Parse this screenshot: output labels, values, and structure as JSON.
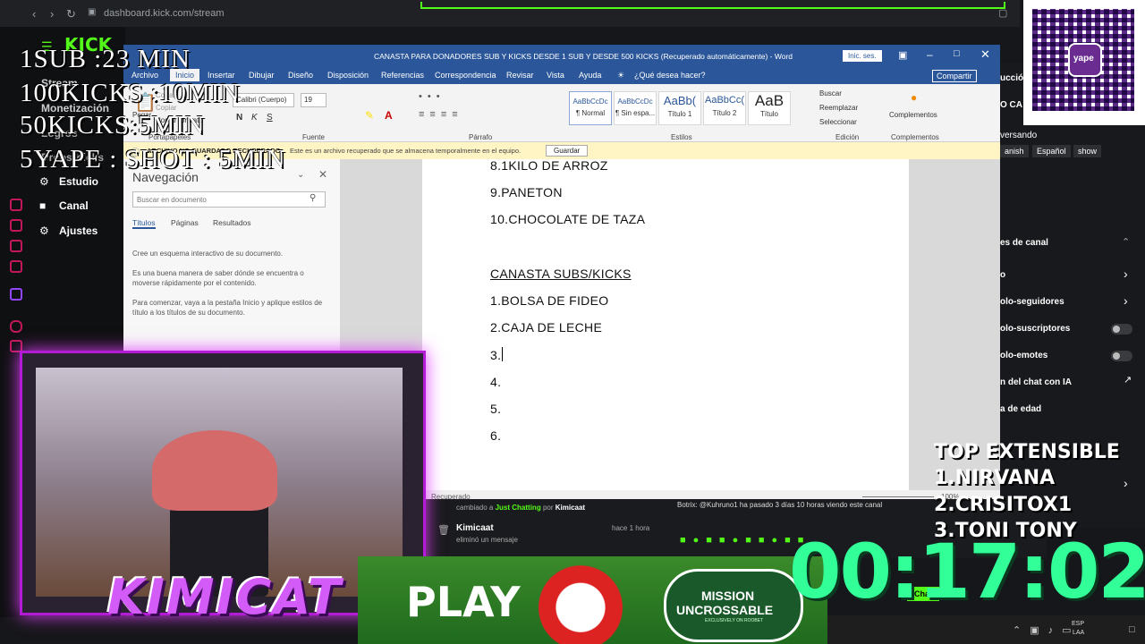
{
  "browser": {
    "url": "dashboard.kick.com/stream"
  },
  "kick_sidebar": {
    "logo": "KICK",
    "items": [
      {
        "label": "Stream"
      },
      {
        "label": "Monetización"
      },
      {
        "label": "Logros"
      },
      {
        "label": "Drops Kicks"
      },
      {
        "label": "Estudio"
      },
      {
        "label": "Canal"
      },
      {
        "label": "Ajustes"
      }
    ]
  },
  "overlay": {
    "lines": [
      "1SUB :23 MIN",
      "100KICKS :10MIN",
      "50KICKS:5MIN",
      "5YAPE : SHOT : 5MIN"
    ]
  },
  "word": {
    "title": "CANASTA PARA DONADORES SUB Y KICKS DESDE 1 SUB Y DESDE 500 KICKS (Recuperado automáticamente) - Word",
    "signin": "Inic. ses.",
    "share": "Compartir",
    "tabs": [
      "Archivo",
      "Inicio",
      "Insertar",
      "Dibujar",
      "Diseño",
      "Disposición",
      "Referencias",
      "Correspondencia",
      "Revisar",
      "Vista",
      "Ayuda"
    ],
    "tell_me": "¿Qué desea hacer?",
    "clipboard": {
      "paste": "Pegar",
      "cut": "Cortar",
      "copy": "Copiar",
      "format": "Copiar formato",
      "label": "Portapapeles"
    },
    "font": {
      "name": "Calibri (Cuerpo)",
      "size": "19",
      "label": "Fuente"
    },
    "paragraph_label": "Párrafo",
    "styles": [
      {
        "preview": "AaBbCcDc",
        "name": "¶ Normal"
      },
      {
        "preview": "AaBbCcDc",
        "name": "¶ Sin espa..."
      },
      {
        "preview": "AaBb(",
        "name": "Título 1"
      },
      {
        "preview": "AaBbCc(",
        "name": "Título 2"
      },
      {
        "preview": "AaB",
        "name": "Título"
      }
    ],
    "styles_label": "Estilos",
    "editing": {
      "find": "Buscar",
      "replace": "Reemplazar",
      "select": "Seleccionar",
      "label": "Edición"
    },
    "addins": {
      "label": "Complementos",
      "button": "Complementos"
    },
    "message_bar": {
      "title": "ARCHIVO NO GUARDADO RECUPERADO",
      "text": "Este es un archivo recuperado que se almacena temporalmente en el equipo.",
      "save": "Guardar"
    },
    "nav_pane": {
      "title": "Navegación",
      "search_placeholder": "Buscar en documento",
      "tabs": [
        "Títulos",
        "Páginas",
        "Resultados"
      ],
      "p1": "Cree un esquema interactivo de su documento.",
      "p2": "Es una buena manera de saber dónde se encuentra o moverse rápidamente por el contenido.",
      "p3": "Para comenzar, vaya a la pestaña Inicio y aplique estilos de título a los títulos de su documento."
    },
    "document": {
      "lines": [
        "8.1KILO DE ARROZ",
        "9.PANETON",
        "10.CHOCOLATE DE TAZA"
      ],
      "heading": "CANASTA SUBS/KICKS",
      "list": [
        "1.BOLSA DE FIDEO",
        "2.CAJA DE LECHE",
        "3.",
        "4.",
        "5.",
        "6."
      ]
    },
    "status": {
      "recovered": "Recuperado",
      "zoom": "100%"
    }
  },
  "right_panel": {
    "partial_top": [
      "ucción",
      "O CA",
      "versando"
    ],
    "lang_chips": [
      "anish",
      "Español",
      "show"
    ],
    "section": "es de canal",
    "items": [
      {
        "label": "o",
        "control": "chevron"
      },
      {
        "label": "olo-seguidores",
        "control": "chevron"
      },
      {
        "label": "olo-suscriptores",
        "control": "toggle"
      },
      {
        "label": "olo-emotes",
        "control": "toggle"
      },
      {
        "label": "n del chat con IA",
        "control": "external"
      },
      {
        "label": "a de edad",
        "control": "chevron"
      }
    ]
  },
  "chat": {
    "line1_pre": "cambiado a",
    "line1_link": "Just Chatting",
    "line1_by": "por",
    "line1_user": "Kimicaat",
    "user": "Kimicaat",
    "time": "hace 1 hora",
    "action": "eliminó un mensaje",
    "right_text": "Botrix: @Kuhruno1 ha pasado 3 días 10 horas viendo este canal",
    "chat_button": "Chat"
  },
  "timer": "00:17:02",
  "top_extensible": [
    "TOP EXTENSIBLE",
    "1.NIRVANA",
    "2.CRISITOX1",
    "3.TONI TONY"
  ],
  "banner": {
    "play": "PLAY",
    "mission": "MISSION",
    "uncrossable": "UNCROSSABLE",
    "tagline": "EXCLUSIVELY ON ROOBET"
  },
  "webcam_name": "KIMICAT",
  "qr_label": "yape",
  "taskbar": {
    "lang": "ESP",
    "region": "LAA"
  },
  "colors": {
    "word_blue": "#2b579a",
    "kick_green": "#53fc18",
    "timer_green": "#33ff99",
    "cam_border": "#b31bd6"
  }
}
